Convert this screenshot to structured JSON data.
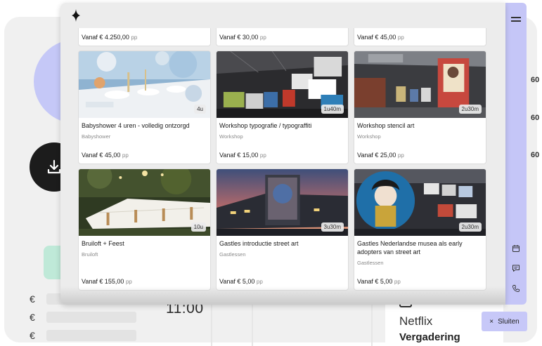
{
  "background": {
    "time": "11:00",
    "currency_symbol": "€",
    "right_numbers": [
      "60",
      "60",
      "60"
    ],
    "event_brand": "Netflix",
    "event_title": "Vergadering",
    "close_label": "Sluiten",
    "close_icon": "×"
  },
  "colors": {
    "accent_lavender": "#c5c6f7",
    "modal_bg": "#ececec",
    "card_bg": "#ffffff"
  },
  "cards_top": [
    {
      "price_prefix": "Vanaf",
      "price": "€ 4.250,00",
      "price_unit": "pp"
    },
    {
      "price_prefix": "Vanaf",
      "price": "€ 30,00",
      "price_unit": "pp"
    },
    {
      "price_prefix": "Vanaf",
      "price": "€ 45,00",
      "price_unit": "pp"
    }
  ],
  "cards": [
    {
      "title": "Babyshower 4 uren - volledig ontzorgd",
      "category": "Babyshower",
      "duration": "4u",
      "price_prefix": "Vanaf",
      "price": "€ 45,00",
      "price_unit": "pp",
      "image": "babyshower-table-photo"
    },
    {
      "title": "Workshop typografie / typograffiti",
      "category": "Workshop",
      "duration": "1u40m",
      "price_prefix": "Vanaf",
      "price": "€ 15,00",
      "price_unit": "pp",
      "image": "street-art-hall-photo"
    },
    {
      "title": "Workshop stencil art",
      "category": "Workshop",
      "duration": "2u30m",
      "price_prefix": "Vanaf",
      "price": "€ 25,00",
      "price_unit": "pp",
      "image": "stencil-art-hall-photo"
    },
    {
      "title": "Bruiloft + Feest",
      "category": "Bruiloft",
      "duration": "10u",
      "price_prefix": "Vanaf",
      "price": "€ 155,00",
      "price_unit": "pp",
      "image": "wedding-garden-photo"
    },
    {
      "title": "Gastles introductie street art",
      "category": "Gastlessen",
      "duration": "3u30m",
      "price_prefix": "Vanaf",
      "price": "€ 5,00",
      "price_unit": "pp",
      "image": "building-mural-dusk-photo"
    },
    {
      "title": "Gastles Nederlandse musea als early adopters van street art",
      "category": "Gastlessen",
      "duration": "2u30m",
      "price_prefix": "Vanaf",
      "price": "€ 5,00",
      "price_unit": "pp",
      "image": "geisha-mural-hall-photo"
    }
  ]
}
